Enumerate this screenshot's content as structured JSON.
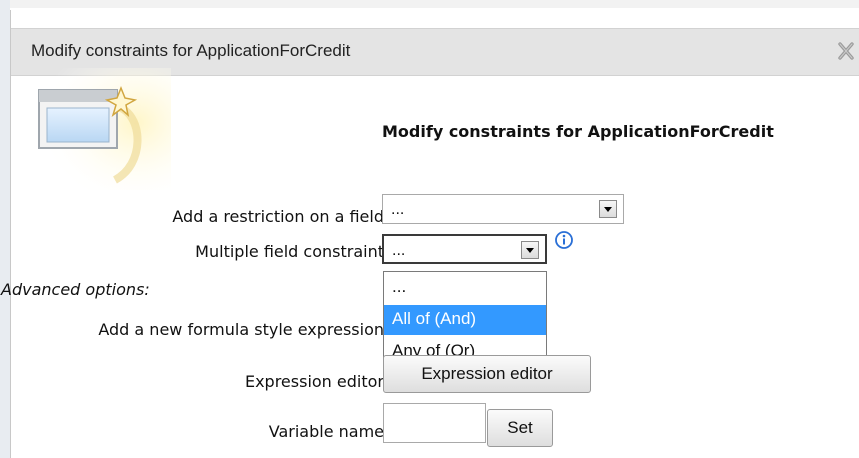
{
  "dialog": {
    "title": "Modify constraints for ApplicationForCredit",
    "heading": "Modify constraints for ApplicationForCredit",
    "close_icon": "close-icon",
    "wizard_icon": "wizard-window-icon"
  },
  "form": {
    "add_restriction_label": "Add a restriction on a field",
    "add_restriction_value": "...",
    "multiple_field_label": "Multiple field constraint",
    "multiple_field_value": "...",
    "info_icon": "info-icon",
    "advanced_options_label": "Advanced options:",
    "formula_label": "Add a new formula style expression",
    "expression_editor_label": "Expression editor",
    "expression_editor_button": "Expression editor",
    "variable_name_label": "Variable name",
    "variable_name_value": "",
    "set_button": "Set"
  },
  "dropdown": {
    "options": [
      "...",
      "All of (And)",
      "Any of (Or)"
    ],
    "highlighted": "All of (And)"
  },
  "colors": {
    "titlebar": "#e4e4e4",
    "highlight": "#3399ff"
  }
}
